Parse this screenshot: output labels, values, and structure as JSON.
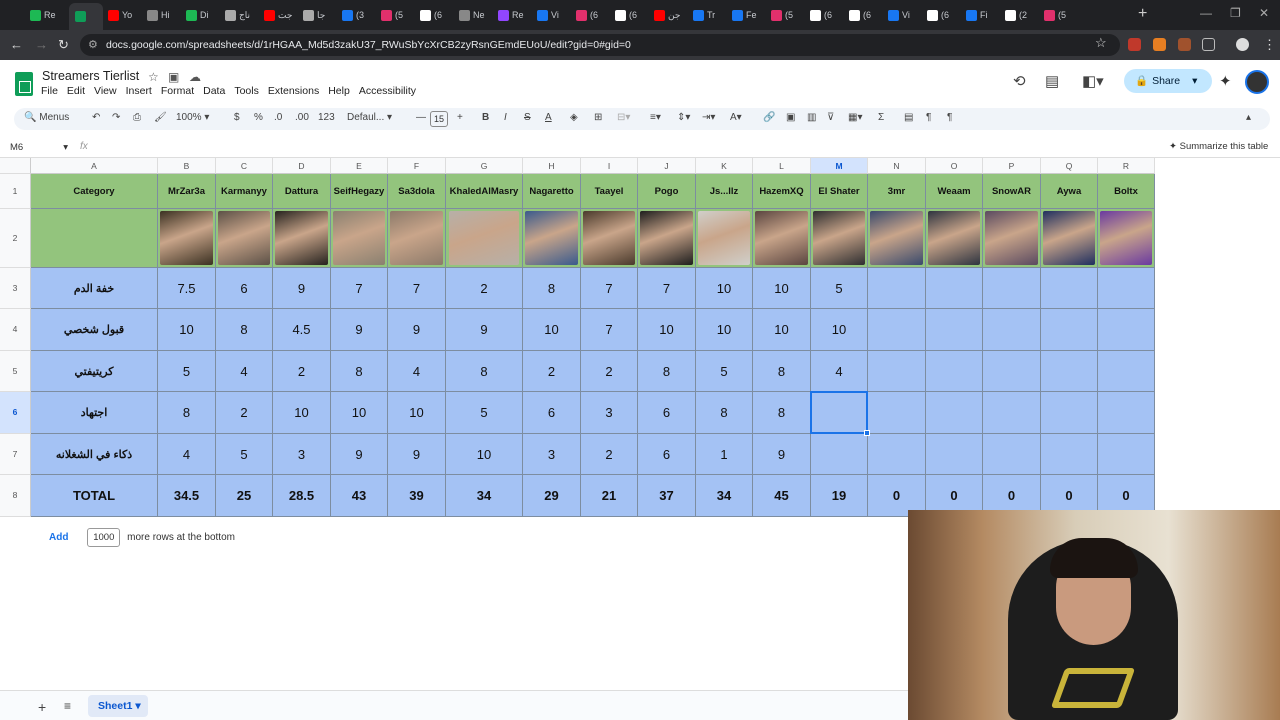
{
  "browser": {
    "tabs": [
      {
        "label": "Re",
        "color": "#1db954"
      },
      {
        "label": "",
        "color": "#0f9d58"
      },
      {
        "label": "Yo",
        "color": "#ff0000"
      },
      {
        "label": "Hi",
        "color": "#888888"
      },
      {
        "label": "Di",
        "color": "#1db954"
      },
      {
        "label": "ناج",
        "color": "#aaaaaa"
      },
      {
        "label": "جت",
        "color": "#ff0000"
      },
      {
        "label": "جا",
        "color": "#aaaaaa"
      },
      {
        "label": "(3",
        "color": "#1877f2"
      },
      {
        "label": "(5",
        "color": "#e1306c"
      },
      {
        "label": "(6",
        "color": "#ffffff"
      },
      {
        "label": "Ne",
        "color": "#888888"
      },
      {
        "label": "Re",
        "color": "#9146ff"
      },
      {
        "label": "Vi",
        "color": "#1877f2"
      },
      {
        "label": "(6",
        "color": "#e1306c"
      },
      {
        "label": "(6",
        "color": "#ffffff"
      },
      {
        "label": "جن",
        "color": "#ff0000"
      },
      {
        "label": "Tr",
        "color": "#1877f2"
      },
      {
        "label": "Fe",
        "color": "#1877f2"
      },
      {
        "label": "(5",
        "color": "#e1306c"
      },
      {
        "label": "(6",
        "color": "#ffffff"
      },
      {
        "label": "(6",
        "color": "#ffffff"
      },
      {
        "label": "Vi",
        "color": "#1877f2"
      },
      {
        "label": "(6",
        "color": "#ffffff"
      },
      {
        "label": "Fi",
        "color": "#1877f2"
      },
      {
        "label": "(2",
        "color": "#ffffff"
      },
      {
        "label": "(5",
        "color": "#e1306c"
      }
    ],
    "url": "docs.google.com/spreadsheets/d/1rHGAA_Md5d3zakU37_RWuSbYcXrCB2zyRsnGEmdEUoU/edit?gid=0#gid=0"
  },
  "doc": {
    "title": "Streamers Tierlist",
    "menu": [
      "File",
      "Edit",
      "View",
      "Insert",
      "Format",
      "Data",
      "Tools",
      "Extensions",
      "Help",
      "Accessibility"
    ],
    "share_label": "Share"
  },
  "toolbar": {
    "menus_label": "Menus",
    "zoom": "100%",
    "currency": "$",
    "percent": "%",
    "dec_decrease": ".0",
    "dec_increase": ".00",
    "number_format": "123",
    "font": "Defaul...",
    "font_size": "15"
  },
  "formula": {
    "name_box": "M6",
    "fx": "fx",
    "summarize": "Summarize this table"
  },
  "sheet": {
    "columns": [
      "A",
      "B",
      "C",
      "D",
      "E",
      "F",
      "G",
      "H",
      "I",
      "J",
      "K",
      "L",
      "M",
      "N",
      "O",
      "P",
      "Q",
      "R"
    ],
    "selected_column": "M",
    "selected_row": 6,
    "header_row": [
      "Category",
      "MrZar3a",
      "Karmanyy",
      "Dattura",
      "SeifHegazy",
      "Sa3dola",
      "KhaledAlMasry",
      "Nagaretto",
      "Taayel",
      "Pogo",
      "Js...llz",
      "HazemXQ",
      "El Shater",
      "3mr",
      "Weaam",
      "SnowAR",
      "Aywa",
      "Boltx"
    ],
    "photo_colors": [
      "#3b3122",
      "#5c5147",
      "#26231f",
      "#8a8070",
      "#8c7a6a",
      "#b7b0a8",
      "#3a5a8c",
      "#4a3a2c",
      "#1e1e1e",
      "#d0cfca",
      "#5a4540",
      "#2e2e30",
      "#3a4a6c",
      "#2e3440",
      "#5a4a60",
      "#1f2f5f",
      "#6a3aa0"
    ],
    "rows": [
      {
        "category": "خفة الدم",
        "values": [
          "7.5",
          "6",
          "9",
          "7",
          "7",
          "2",
          "8",
          "7",
          "7",
          "10",
          "10",
          "5",
          "",
          "",
          "",
          "",
          ""
        ]
      },
      {
        "category": "قبول شخصي",
        "values": [
          "10",
          "8",
          "4.5",
          "9",
          "9",
          "9",
          "10",
          "7",
          "10",
          "10",
          "10",
          "10",
          "",
          "",
          "",
          "",
          ""
        ]
      },
      {
        "category": "كريتيفتي",
        "values": [
          "5",
          "4",
          "2",
          "8",
          "4",
          "8",
          "2",
          "2",
          "8",
          "5",
          "8",
          "4",
          "",
          "",
          "",
          "",
          ""
        ]
      },
      {
        "category": "اجتهاد",
        "values": [
          "8",
          "2",
          "10",
          "10",
          "10",
          "5",
          "6",
          "3",
          "6",
          "8",
          "8",
          "",
          "",
          "",
          "",
          "",
          ""
        ]
      },
      {
        "category": "ذكاء في الشغلانه",
        "values": [
          "4",
          "5",
          "3",
          "9",
          "9",
          "10",
          "3",
          "2",
          "6",
          "1",
          "9",
          "",
          "",
          "",
          "",
          "",
          ""
        ]
      },
      {
        "category": "TOTAL",
        "values": [
          "34.5",
          "25",
          "28.5",
          "43",
          "39",
          "34",
          "29",
          "21",
          "37",
          "34",
          "45",
          "19",
          "0",
          "0",
          "0",
          "0",
          "0"
        ]
      }
    ]
  },
  "footer": {
    "add_label": "Add",
    "rows_value": "1000",
    "rows_suffix": "more rows at the bottom",
    "sheet_name": "Sheet1"
  }
}
